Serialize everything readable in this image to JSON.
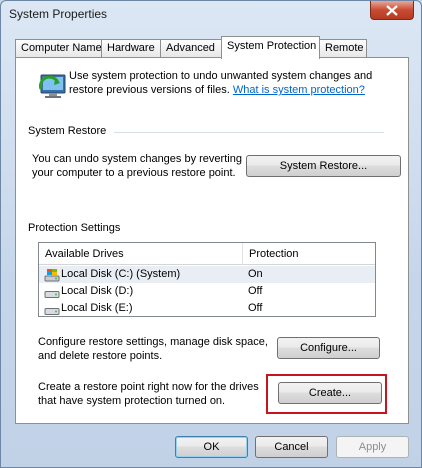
{
  "window": {
    "title": "System Properties",
    "close_icon": "close-icon"
  },
  "tabs": [
    {
      "label": "Computer Name",
      "active": false
    },
    {
      "label": "Hardware",
      "active": false
    },
    {
      "label": "Advanced",
      "active": false
    },
    {
      "label": "System Protection",
      "active": true
    },
    {
      "label": "Remote",
      "active": false
    }
  ],
  "intro": {
    "icon": "system-protection-icon",
    "text": "Use system protection to undo unwanted system changes and restore previous versions of files.",
    "link": "What is system protection?"
  },
  "system_restore": {
    "section_label": "System Restore",
    "description": "You can undo system changes by reverting your computer to a previous restore point.",
    "button": "System Restore..."
  },
  "protection_settings": {
    "section_label": "Protection Settings",
    "columns": [
      "Available Drives",
      "Protection"
    ],
    "drives": [
      {
        "name": "Local Disk (C:) (System)",
        "protection": "On",
        "icon": "system-drive-icon"
      },
      {
        "name": "Local Disk (D:)",
        "protection": "Off",
        "icon": "drive-icon"
      },
      {
        "name": "Local Disk (E:)",
        "protection": "Off",
        "icon": "drive-icon"
      }
    ],
    "configure_text": "Configure restore settings, manage disk space, and delete restore points.",
    "configure_button": "Configure...",
    "create_text": "Create a restore point right now for the drives that have system protection turned on.",
    "create_button": "Create..."
  },
  "footer": {
    "ok": "OK",
    "cancel": "Cancel",
    "apply": "Apply"
  },
  "colors": {
    "highlight_box": "#c4161c",
    "link": "#0066cc"
  }
}
